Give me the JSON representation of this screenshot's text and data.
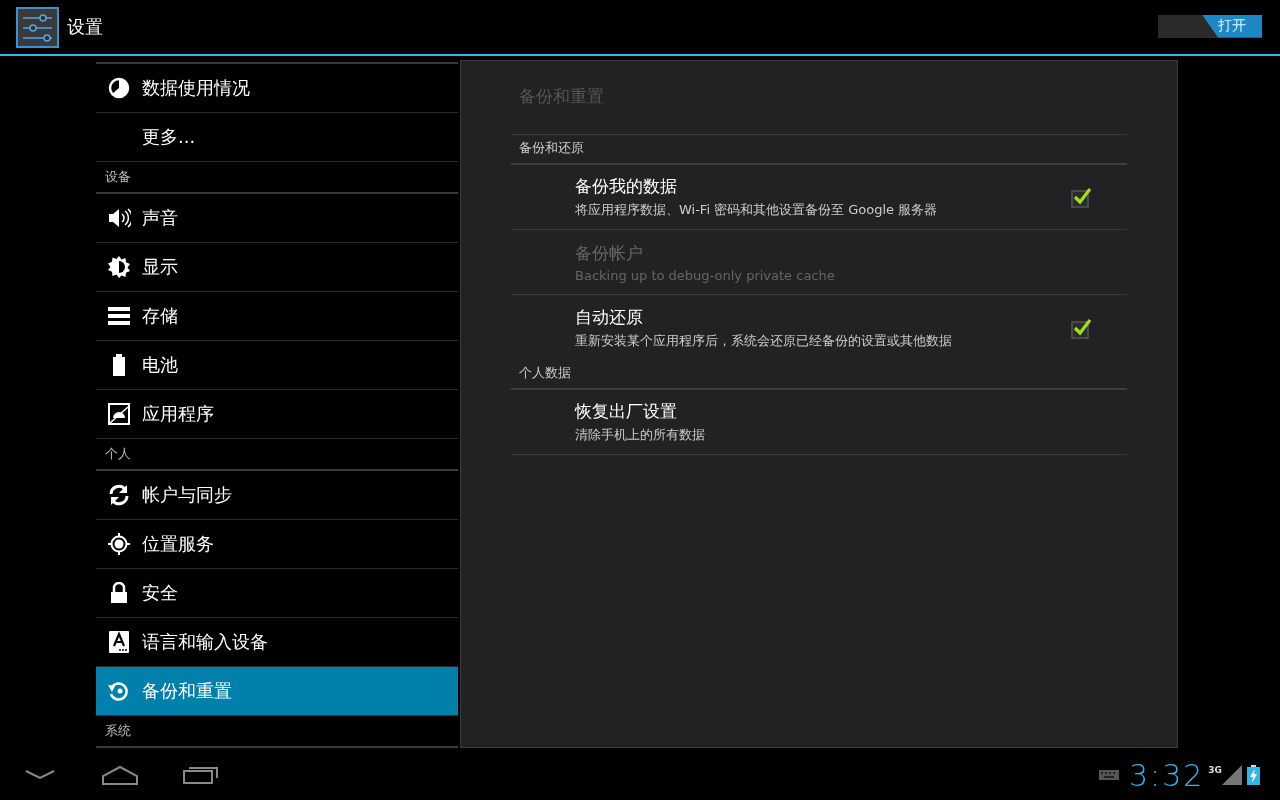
{
  "action_bar": {
    "title": "设置",
    "switch": {
      "label": "打开",
      "on": true
    }
  },
  "sidebar": {
    "items": [
      {
        "kind": "item",
        "label": "数据使用情况",
        "selected": false
      },
      {
        "kind": "item",
        "label": "更多...",
        "selected": false
      },
      {
        "kind": "header",
        "label": "设备"
      },
      {
        "kind": "item",
        "label": "声音",
        "selected": false
      },
      {
        "kind": "item",
        "label": "显示",
        "selected": false
      },
      {
        "kind": "item",
        "label": "存储",
        "selected": false
      },
      {
        "kind": "item",
        "label": "电池",
        "selected": false
      },
      {
        "kind": "item",
        "label": "应用程序",
        "selected": false
      },
      {
        "kind": "header",
        "label": "个人"
      },
      {
        "kind": "item",
        "label": "帐户与同步",
        "selected": false
      },
      {
        "kind": "item",
        "label": "位置服务",
        "selected": false
      },
      {
        "kind": "item",
        "label": "安全",
        "selected": false
      },
      {
        "kind": "item",
        "label": "语言和输入设备",
        "selected": false
      },
      {
        "kind": "item",
        "label": "备份和重置",
        "selected": true
      },
      {
        "kind": "header",
        "label": "系统"
      }
    ]
  },
  "detail": {
    "title": "备份和重置",
    "sections": [
      {
        "header": "备份和还原",
        "items": [
          {
            "kind": "checkbox",
            "title": "备份我的数据",
            "summary": "将应用程序数据、Wi-Fi 密码和其他设置备份至 Google 服务器",
            "disabled": false,
            "checked": true
          },
          {
            "kind": "plain",
            "title": "备份帐户",
            "summary": "Backing up to debug-only private cache",
            "disabled": true
          },
          {
            "kind": "checkbox",
            "title": "自动还原",
            "summary": "重新安装某个应用程序后，系统会还原已经备份的设置或其他数据",
            "disabled": false,
            "checked": true
          }
        ]
      },
      {
        "header": "个人数据",
        "items": [
          {
            "kind": "plain",
            "title": "恢复出厂设置",
            "summary": "清除手机上的所有数据",
            "disabled": false
          }
        ]
      }
    ]
  },
  "status_bar": {
    "time": "3:32",
    "network": "3G"
  }
}
